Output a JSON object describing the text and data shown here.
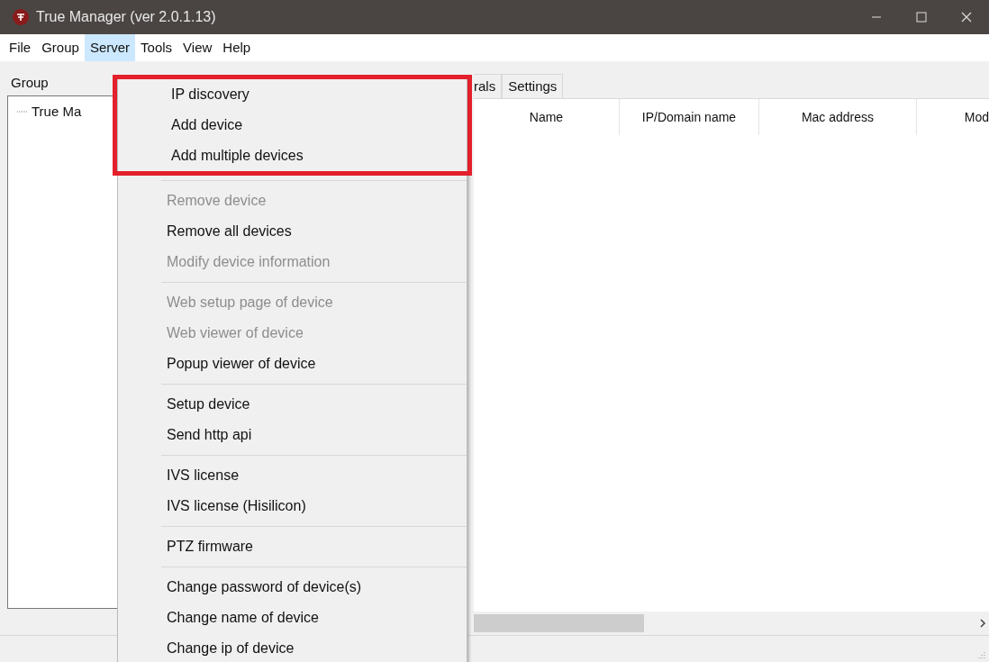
{
  "window": {
    "title": "True Manager (ver 2.0.1.13)"
  },
  "menubar": [
    {
      "label": "File",
      "selected": false
    },
    {
      "label": "Group",
      "selected": false
    },
    {
      "label": "Server",
      "selected": true
    },
    {
      "label": "Tools",
      "selected": false
    },
    {
      "label": "View",
      "selected": false
    },
    {
      "label": "Help",
      "selected": false
    }
  ],
  "group_panel": {
    "header": "Group",
    "tree": [
      {
        "label": "True Ma"
      }
    ]
  },
  "tabs": [
    {
      "label": "rals",
      "selected": false
    },
    {
      "label": "Settings",
      "selected": false
    }
  ],
  "table": {
    "columns": [
      "Name",
      "IP/Domain name",
      "Mac address",
      "Mod"
    ]
  },
  "server_menu": [
    {
      "kind": "item",
      "label": "IP discovery",
      "disabled": false,
      "highlighted": true
    },
    {
      "kind": "item",
      "label": "Add device",
      "disabled": false,
      "highlighted": true
    },
    {
      "kind": "item",
      "label": "Add multiple devices",
      "disabled": false,
      "highlighted": true
    },
    {
      "kind": "separator"
    },
    {
      "kind": "item",
      "label": "Remove device",
      "disabled": true,
      "highlighted": false
    },
    {
      "kind": "item",
      "label": "Remove all devices",
      "disabled": false,
      "highlighted": false
    },
    {
      "kind": "item",
      "label": "Modify device information",
      "disabled": true,
      "highlighted": false
    },
    {
      "kind": "separator"
    },
    {
      "kind": "item",
      "label": "Web setup page of device",
      "disabled": true,
      "highlighted": false
    },
    {
      "kind": "item",
      "label": "Web viewer of device",
      "disabled": true,
      "highlighted": false
    },
    {
      "kind": "item",
      "label": "Popup viewer of device",
      "disabled": false,
      "highlighted": false
    },
    {
      "kind": "separator"
    },
    {
      "kind": "item",
      "label": "Setup device",
      "disabled": false,
      "highlighted": false
    },
    {
      "kind": "item",
      "label": "Send http api",
      "disabled": false,
      "highlighted": false
    },
    {
      "kind": "separator"
    },
    {
      "kind": "item",
      "label": "IVS license",
      "disabled": false,
      "highlighted": false
    },
    {
      "kind": "item",
      "label": "IVS license (Hisilicon)",
      "disabled": false,
      "highlighted": false
    },
    {
      "kind": "separator"
    },
    {
      "kind": "item",
      "label": "PTZ firmware",
      "disabled": false,
      "highlighted": false
    },
    {
      "kind": "separator"
    },
    {
      "kind": "item",
      "label": "Change password of device(s)",
      "disabled": false,
      "highlighted": false
    },
    {
      "kind": "item",
      "label": "Change name of device",
      "disabled": false,
      "highlighted": false
    },
    {
      "kind": "item",
      "label": "Change ip of device",
      "disabled": false,
      "highlighted": false
    }
  ]
}
